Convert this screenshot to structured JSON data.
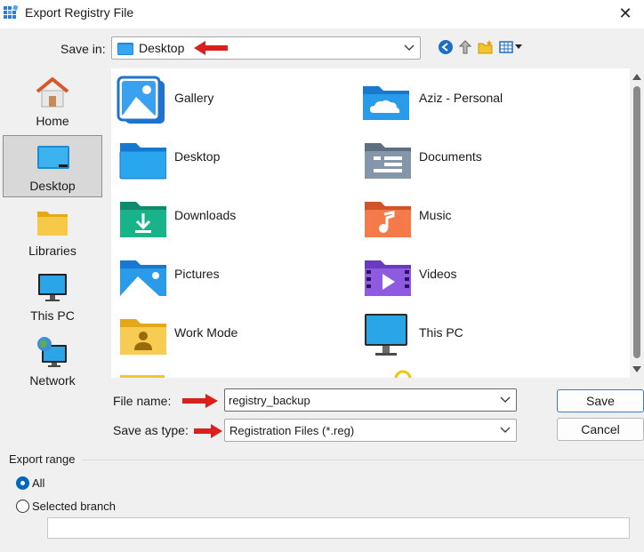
{
  "window": {
    "title": "Export Registry File",
    "close_glyph": "✕"
  },
  "save_in": {
    "label": "Save in:",
    "value": "Desktop"
  },
  "toolbar": {
    "icons": [
      "back-icon",
      "up-folder-icon",
      "new-folder-icon",
      "view-menu-icon"
    ]
  },
  "places": [
    {
      "label": "Home",
      "icon": "home-icon"
    },
    {
      "label": "Desktop",
      "icon": "desktop-icon",
      "selected": true
    },
    {
      "label": "Libraries",
      "icon": "libraries-folder-icon"
    },
    {
      "label": "This PC",
      "icon": "monitor-icon"
    },
    {
      "label": "Network",
      "icon": "network-icon"
    }
  ],
  "files": [
    {
      "label": "Gallery",
      "icon": "gallery-icon"
    },
    {
      "label": "Aziz - Personal",
      "icon": "onedrive-folder-icon"
    },
    {
      "label": "Desktop",
      "icon": "desktop-folder-icon"
    },
    {
      "label": "Documents",
      "icon": "documents-folder-icon"
    },
    {
      "label": "Downloads",
      "icon": "downloads-folder-icon"
    },
    {
      "label": "Music",
      "icon": "music-folder-icon"
    },
    {
      "label": "Pictures",
      "icon": "pictures-folder-icon"
    },
    {
      "label": "Videos",
      "icon": "videos-folder-icon"
    },
    {
      "label": "Work Mode",
      "icon": "user-folder-icon"
    },
    {
      "label": "This PC",
      "icon": "monitor-icon"
    }
  ],
  "file_name": {
    "label": "File name:",
    "value": "registry_backup"
  },
  "save_as_type": {
    "label": "Save as type:",
    "value": "Registration Files (*.reg)"
  },
  "buttons": {
    "save": "Save",
    "cancel": "Cancel"
  },
  "export_range": {
    "legend": "Export range",
    "options": [
      {
        "label": "All",
        "checked": true
      },
      {
        "label": "Selected branch",
        "checked": false
      }
    ],
    "branch_value": ""
  },
  "colors": {
    "accent": "#0067c0",
    "annotation_arrow": "#d9201a",
    "folder_blue": "#1e88d9",
    "folder_yellow": "#f4c430"
  }
}
